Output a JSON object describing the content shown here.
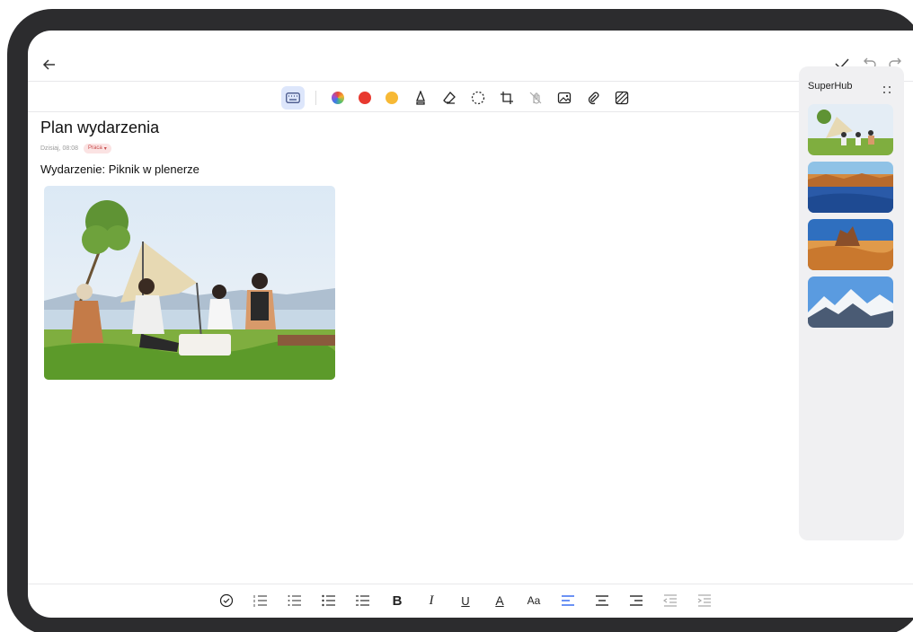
{
  "app": {
    "toolbar": {
      "tools": [
        "keyboard-icon",
        "color-wheel-icon",
        "red-color-dot",
        "yellow-color-dot",
        "pen-icon",
        "eraser-icon",
        "lasso-icon",
        "crop-icon",
        "hand-draw-disabled-icon",
        "image-icon",
        "attachment-icon",
        "texture-icon"
      ],
      "colors": {
        "red": "#e8392f",
        "yellow": "#f7b935",
        "active_bg": "#dde6fb"
      }
    },
    "header": {
      "actions": [
        "check-icon",
        "undo-icon",
        "redo-icon"
      ]
    }
  },
  "note": {
    "title": "Plan wydarzenia",
    "date": "Dzisiaj, 08:08",
    "tag": "Praca",
    "subtitle": "Wydarzenie: Piknik w plenerze",
    "image": "picnic-photo"
  },
  "superhub": {
    "title": "SuperHub",
    "thumbnails": [
      "picnic-thumbnail",
      "lake-desert-thumbnail",
      "desert-rock-thumbnail",
      "snowy-mountains-thumbnail"
    ]
  },
  "format_bar": {
    "bold": "B",
    "italic": "I",
    "underline": "U",
    "font_color": "A",
    "font_size": "Aa",
    "accent": "#3a6ff0"
  }
}
